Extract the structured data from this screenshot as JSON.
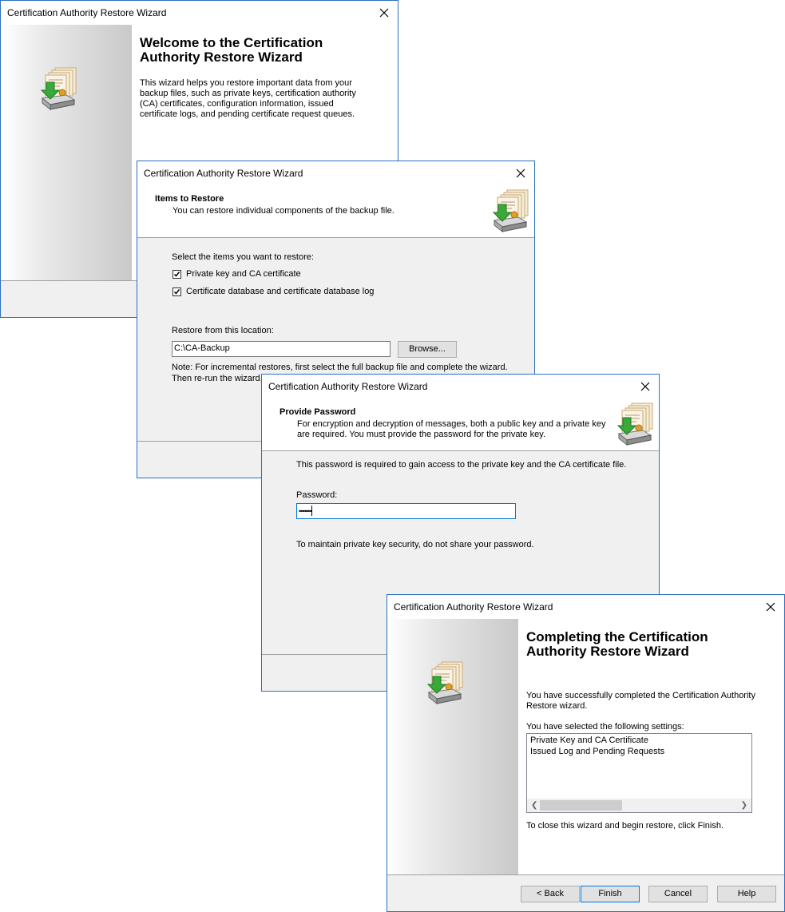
{
  "welcome": {
    "window_title": "Certification Authority Restore Wizard",
    "heading": "Welcome to the Certification Authority Restore Wizard",
    "description": "This wizard helps you restore important data from your backup files, such as private keys, certification authority (CA) certificates, configuration information, issued certificate logs, and pending certificate request queues."
  },
  "items": {
    "window_title": "Certification Authority Restore Wizard",
    "header_title": "Items to Restore",
    "header_subtitle": "You can restore individual components of the backup file.",
    "select_prompt": "Select the items you want to restore:",
    "checkbox1_label": "Private key and CA certificate",
    "checkbox1_checked": true,
    "checkbox2_label": "Certificate database and certificate database log",
    "checkbox2_checked": true,
    "location_label": "Restore from this location:",
    "location_value": "C:\\CA-Backup",
    "browse_label": "Browse...",
    "note_line1": "Note: For incremental restores, first select the full backup file and complete the wizard.",
    "note_line2": "Then re-run the wizard,"
  },
  "password": {
    "window_title": "Certification Authority Restore Wizard",
    "header_title": "Provide Password",
    "header_subtitle": "For encryption and decryption of messages, both a public key and a private key are required. You must provide the password for the private key.",
    "info_text": "This password is required to gain access to the private key and the CA certificate file.",
    "password_label": "Password:",
    "password_value": "•••••••••",
    "security_note": "To maintain private key security, do not share your password."
  },
  "complete": {
    "window_title": "Certification Authority Restore Wizard",
    "heading": "Completing the Certification Authority Restore Wizard",
    "success_text": "You have successfully completed the Certification Authority Restore wizard.",
    "settings_label": "You have selected the following settings:",
    "settings_items": [
      "Private Key and CA Certificate",
      "Issued Log and Pending Requests"
    ],
    "finish_instruction": "To close this wizard and begin restore, click Finish.",
    "buttons": {
      "back": "< Back",
      "finish": "Finish",
      "cancel": "Cancel",
      "help": "Help"
    }
  },
  "icons": {
    "close": "close-icon",
    "wizard": "certificate-restore-icon"
  },
  "colors": {
    "window_border": "#2b6fc2",
    "default_button_border": "#0078d7"
  }
}
